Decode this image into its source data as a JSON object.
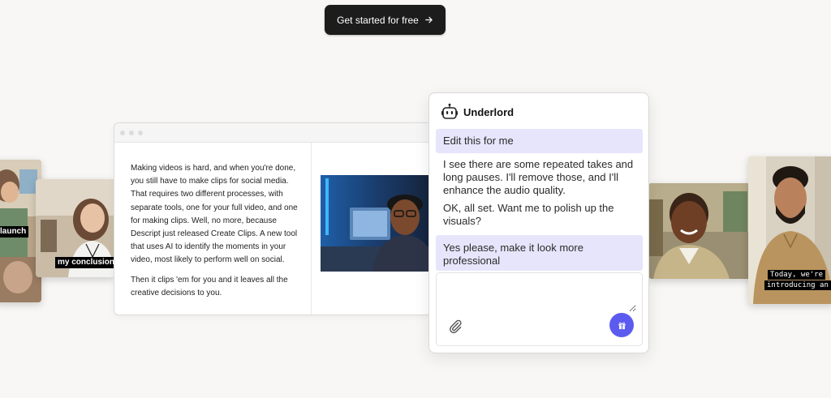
{
  "cta": {
    "label": "Get started for free"
  },
  "thumbs": {
    "left_far_caption": "launch",
    "left_near_caption": "my conclusions",
    "right_far_caption_line1": "Today, we're",
    "right_far_caption_line2": "introducing an"
  },
  "editor": {
    "paragraph1": "Making videos is hard, and when you're done, you still have to make clips for social media. That requires two different processes, with separate tools, one for your full video, and one for making clips. Well, no more, because Descript just released Create Clips. A new tool that uses AI to identify the moments in your video, most likely to perform well on social.",
    "paragraph2": "Then it clips 'em for you and it leaves all the creative decisions to you."
  },
  "chat": {
    "title": "Underlord",
    "user_msg_1": "Edit this for me",
    "bot_msg_1": "I see there are some repeated takes and long pauses. I'll remove those, and I'll enhance the audio quality.",
    "bot_msg_2": "OK, all set. Want me to polish up the visuals?",
    "user_msg_2": "Yes please, make it look more professional",
    "composer_value": ""
  },
  "colors": {
    "cta_bg": "#1c1c1c",
    "user_bubble": "#e7e5fb",
    "send_button": "#5b5bf0",
    "page_bg": "#f8f7f5"
  },
  "icons": {
    "cta": "arrow-right-icon",
    "chat_header": "robot-icon",
    "attach": "paperclip-icon",
    "send": "gift-icon"
  }
}
